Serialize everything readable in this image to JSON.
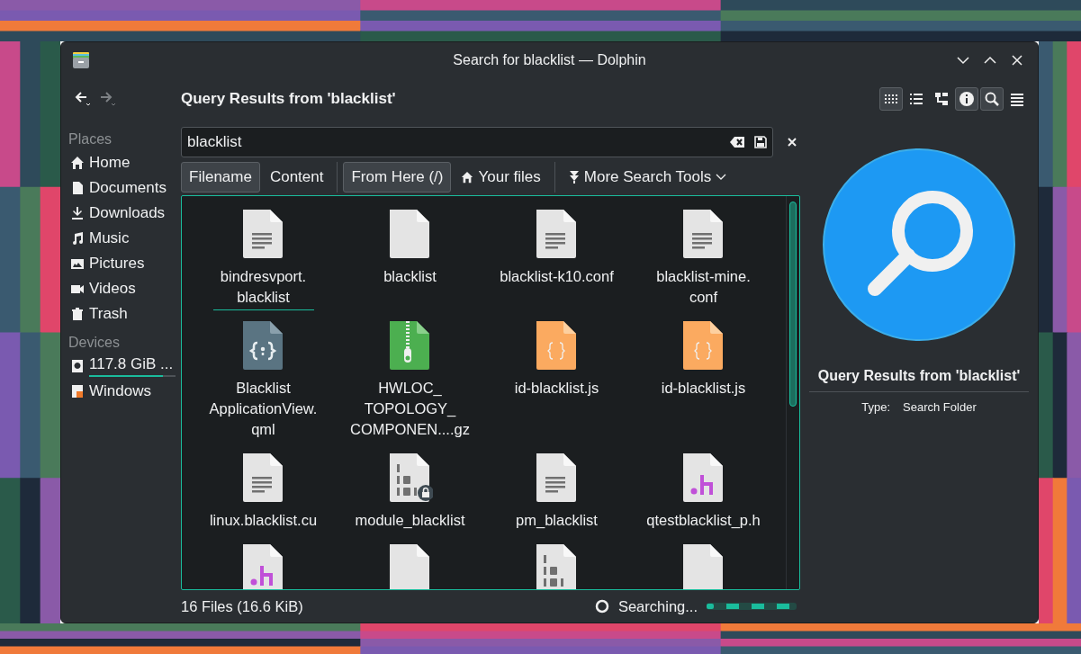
{
  "window": {
    "title": "Search for blacklist — Dolphin"
  },
  "toolbar": {
    "location": "Query Results from 'blacklist'",
    "view_buttons": [
      {
        "kind": "icons",
        "selected": true
      },
      {
        "kind": "details",
        "selected": false
      },
      {
        "kind": "tree",
        "selected": false
      },
      {
        "kind": "info",
        "selected": true
      },
      {
        "kind": "search",
        "selected": true
      },
      {
        "kind": "menu",
        "selected": false
      }
    ]
  },
  "sidebar": {
    "sections": [
      {
        "title": "Places",
        "items": [
          {
            "kind": "home",
            "label": "Home"
          },
          {
            "kind": "document",
            "label": "Documents"
          },
          {
            "kind": "download",
            "label": "Downloads"
          },
          {
            "kind": "music",
            "label": "Music"
          },
          {
            "kind": "picture",
            "label": "Pictures"
          },
          {
            "kind": "video",
            "label": "Videos"
          },
          {
            "kind": "trash",
            "label": "Trash"
          }
        ]
      },
      {
        "title": "Devices",
        "items": [
          {
            "kind": "disk",
            "label": "117.8 GiB ...",
            "level": 0.85
          },
          {
            "kind": "windows",
            "label": "Windows"
          }
        ]
      }
    ]
  },
  "search": {
    "value": "blacklist"
  },
  "filter_groups": [
    [
      {
        "label": "Filename",
        "selected": true
      },
      {
        "label": "Content",
        "selected": false
      }
    ],
    [
      {
        "label": "From Here (/)",
        "selected": true
      },
      {
        "label": "Your files",
        "selected": false,
        "kind": "home"
      }
    ]
  ],
  "more_tools": {
    "label": "More Search Tools"
  },
  "files": [
    {
      "kind": "text",
      "name": "bindresvport.\nblacklist",
      "focused": true
    },
    {
      "kind": "blank",
      "name": "blacklist",
      "focused": false
    },
    {
      "kind": "text",
      "name": "blacklist-k10.conf",
      "focused": false
    },
    {
      "kind": "text",
      "name": "blacklist-mine.\nconf",
      "focused": false
    },
    {
      "kind": "qml",
      "name": "Blacklist\nApplicationView.\nqml",
      "focused": false
    },
    {
      "kind": "zip",
      "name": "HWLOC_\nTOPOLOGY_\nCOMPONEN....gz",
      "focused": false
    },
    {
      "kind": "js",
      "name": "id-blacklist.js",
      "focused": false
    },
    {
      "kind": "js",
      "name": "id-blacklist.js",
      "focused": false
    },
    {
      "kind": "text",
      "name": "linux.blacklist.cu",
      "focused": false
    },
    {
      "kind": "binary-locked",
      "name": "module_blacklist",
      "focused": false
    },
    {
      "kind": "text",
      "name": "pm_blacklist",
      "focused": false
    },
    {
      "kind": "header",
      "name": "qtestblacklist_p.h",
      "focused": false
    },
    {
      "kind": "header"
    },
    {
      "kind": "blank"
    },
    {
      "kind": "binary"
    },
    {
      "kind": "blank"
    }
  ],
  "info_panel": {
    "title": "Query Results from 'blacklist'",
    "properties": [
      {
        "label": "Type:",
        "value": "Search Folder"
      }
    ]
  },
  "status_bar": {
    "summary": "16 Files (16.6 KiB)",
    "activity": "Searching..."
  }
}
